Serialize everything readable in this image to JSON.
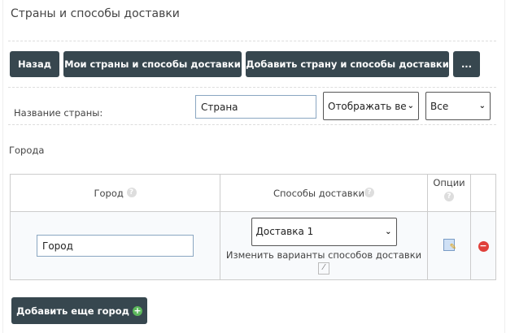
{
  "title": "Страны и способы доставки",
  "toolbar": {
    "back": "Назад",
    "my_countries": "Мои страны и способы доставки",
    "add_country": "Добавить страну и способы доставки",
    "more": "..."
  },
  "filter": {
    "label": "Название страны:",
    "country_value": "Страна",
    "display_select": "Отображать ве",
    "all_select": "Все"
  },
  "cities_label": "Города",
  "table": {
    "headers": [
      "Город",
      "Способы доставки",
      "Опции"
    ],
    "rows": [
      {
        "city": "Город",
        "delivery": "Доставка 1",
        "edit_link": "Изменить варианты способов доставки"
      }
    ]
  },
  "add_city": "Добавить еще город",
  "colors": {
    "button": "#37474f",
    "input_border": "#8aa6c1"
  }
}
